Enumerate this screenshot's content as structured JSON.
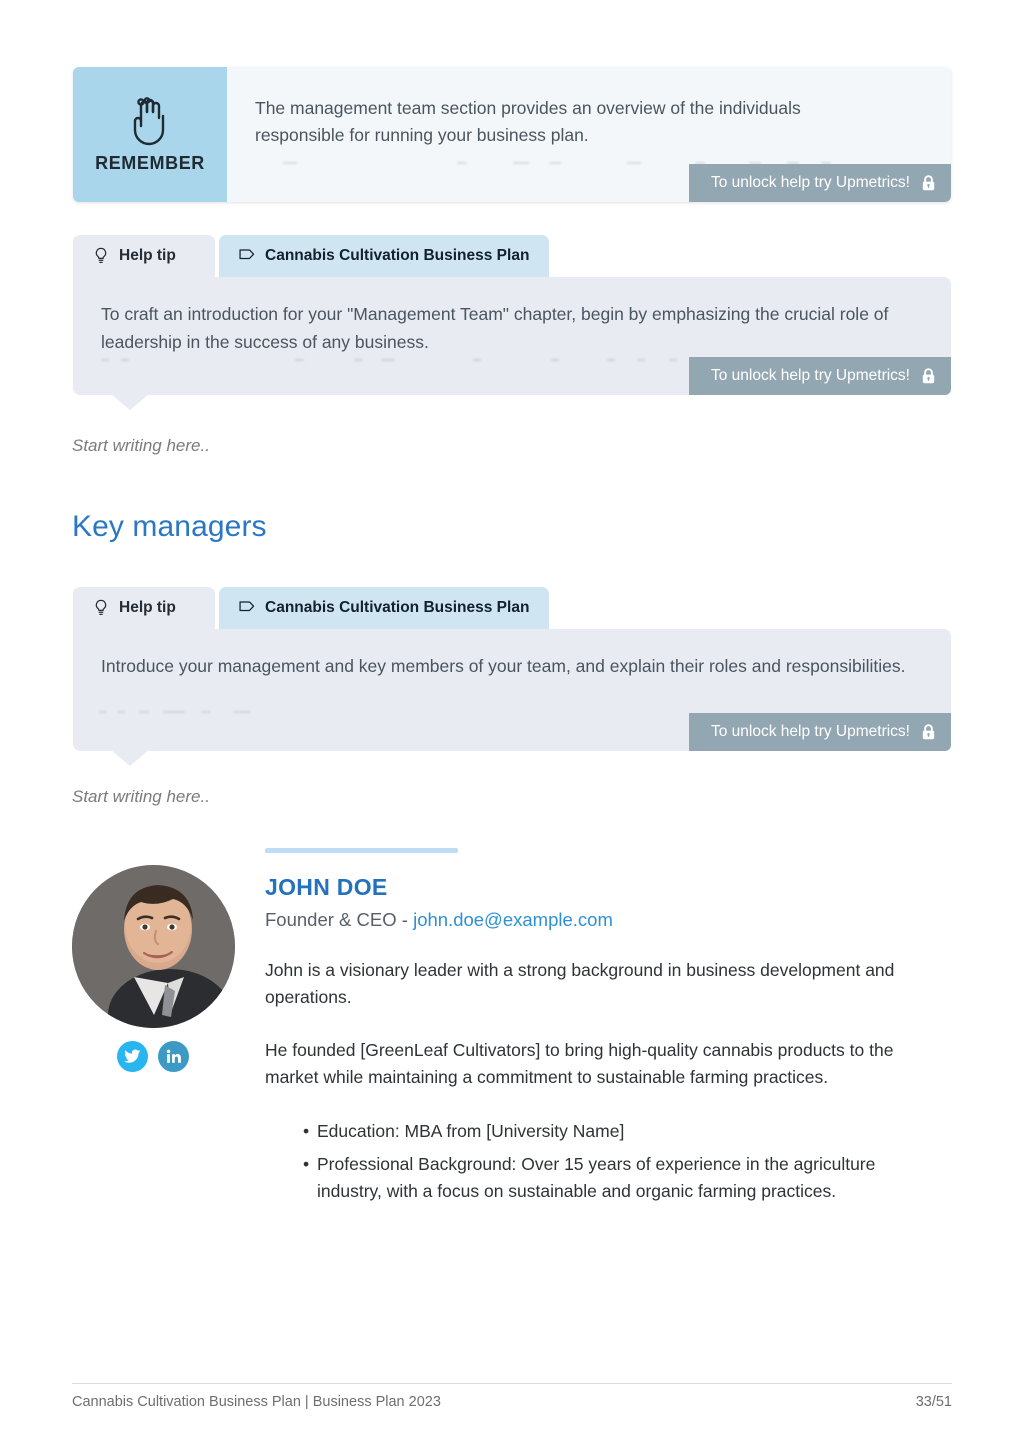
{
  "remember_card": {
    "icon": "hand-with-string-icon",
    "label": "REMEMBER",
    "text": "The management team section provides an overview of the individuals responsible for running your business plan.",
    "unlock_badge": {
      "label": "To unlock help try Upmetrics!",
      "icon": "lock-icon"
    },
    "colors": {
      "panel_blue": "#a9d6ea",
      "body_bg": "#f4f7f9",
      "badge_bg": "#93a7b3"
    }
  },
  "tips": [
    {
      "tabs": {
        "help_tab": {
          "label": "Help tip",
          "icon": "lightbulb-icon"
        },
        "plan_tab": {
          "label": "Cannabis Cultivation Business Plan",
          "icon": "tag-icon"
        }
      },
      "text": "To craft an introduction for your \"Management Team\" chapter, begin by emphasizing the crucial role of leadership in the success of any business.",
      "unlock_badge": {
        "label": "To unlock help try Upmetrics!",
        "icon": "lock-icon"
      }
    },
    {
      "tabs": {
        "help_tab": {
          "label": "Help tip",
          "icon": "lightbulb-icon"
        },
        "plan_tab": {
          "label": "Cannabis Cultivation Business Plan",
          "icon": "tag-icon"
        }
      },
      "text": "Introduce your management and key members of your team, and explain their roles and responsibilities.",
      "unlock_badge": {
        "label": "To unlock help try Upmetrics!",
        "icon": "lock-icon"
      }
    }
  ],
  "placeholders": {
    "first": "Start writing here..",
    "second": "Start writing here.."
  },
  "section": {
    "heading": "Key managers",
    "heading_color": "#2a77c4"
  },
  "profile": {
    "avatar_alt": "profile-photo",
    "name": "JOHN DOE",
    "role": "Founder & CEO",
    "role_separator": " - ",
    "email": "john.doe@example.com",
    "paragraphs": [
      "John is a visionary leader with a strong background in business development and operations.",
      "He founded [GreenLeaf Cultivators] to bring high-quality cannabis products to the market while maintaining a commitment to sustainable farming practices."
    ],
    "bullets": [
      "Education: MBA from [University Name]",
      "Professional Background: Over 15 years of experience in the agriculture industry, with a focus on sustainable and organic farming practices."
    ],
    "bullet_char": "•",
    "socials": [
      {
        "name": "twitter",
        "color": "#29b5f0"
      },
      {
        "name": "linkedin",
        "color": "#3c9ac4"
      }
    ],
    "accent_color": "#bfdcf5"
  },
  "footer": {
    "left": "Cannabis Cultivation Business Plan | Business Plan 2023",
    "right": "33/51"
  }
}
